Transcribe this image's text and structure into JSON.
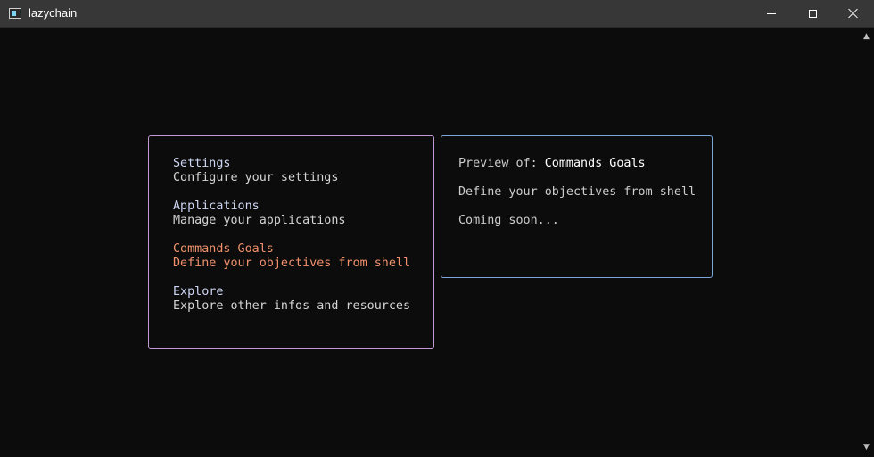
{
  "window": {
    "title": "lazychain",
    "icon": "terminal-icon"
  },
  "colors": {
    "background": "#0c0c0c",
    "titlebar": "#373737",
    "menu_border": "#c39ad6",
    "preview_border": "#7aa6da",
    "selected": "#f0916c"
  },
  "menu": {
    "items": [
      {
        "title": "Settings",
        "description": "Configure your settings"
      },
      {
        "title": "Applications",
        "description": "Manage your applications"
      },
      {
        "title": "Commands Goals",
        "description": "Define your objectives from shell",
        "selected": true
      },
      {
        "title": "Explore",
        "description": "Explore other infos and resources"
      }
    ]
  },
  "preview": {
    "label": "Preview of: ",
    "selected_name": "Commands Goals",
    "description": "Define your objectives from shell",
    "status": "Coming soon..."
  }
}
